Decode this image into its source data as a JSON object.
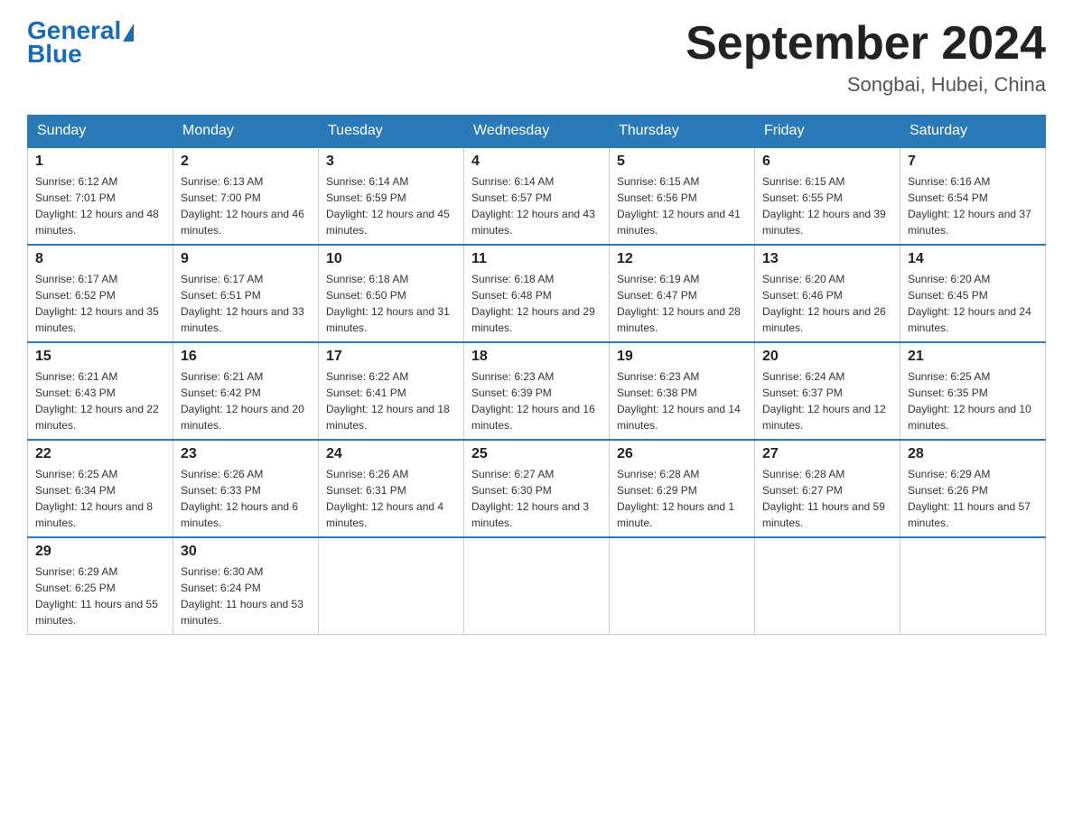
{
  "header": {
    "logo_general": "General",
    "logo_blue": "Blue",
    "month_title": "September 2024",
    "location": "Songbai, Hubei, China"
  },
  "days_of_week": [
    "Sunday",
    "Monday",
    "Tuesday",
    "Wednesday",
    "Thursday",
    "Friday",
    "Saturday"
  ],
  "weeks": [
    [
      {
        "day": "1",
        "sunrise": "6:12 AM",
        "sunset": "7:01 PM",
        "daylight": "12 hours and 48 minutes."
      },
      {
        "day": "2",
        "sunrise": "6:13 AM",
        "sunset": "7:00 PM",
        "daylight": "12 hours and 46 minutes."
      },
      {
        "day": "3",
        "sunrise": "6:14 AM",
        "sunset": "6:59 PM",
        "daylight": "12 hours and 45 minutes."
      },
      {
        "day": "4",
        "sunrise": "6:14 AM",
        "sunset": "6:57 PM",
        "daylight": "12 hours and 43 minutes."
      },
      {
        "day": "5",
        "sunrise": "6:15 AM",
        "sunset": "6:56 PM",
        "daylight": "12 hours and 41 minutes."
      },
      {
        "day": "6",
        "sunrise": "6:15 AM",
        "sunset": "6:55 PM",
        "daylight": "12 hours and 39 minutes."
      },
      {
        "day": "7",
        "sunrise": "6:16 AM",
        "sunset": "6:54 PM",
        "daylight": "12 hours and 37 minutes."
      }
    ],
    [
      {
        "day": "8",
        "sunrise": "6:17 AM",
        "sunset": "6:52 PM",
        "daylight": "12 hours and 35 minutes."
      },
      {
        "day": "9",
        "sunrise": "6:17 AM",
        "sunset": "6:51 PM",
        "daylight": "12 hours and 33 minutes."
      },
      {
        "day": "10",
        "sunrise": "6:18 AM",
        "sunset": "6:50 PM",
        "daylight": "12 hours and 31 minutes."
      },
      {
        "day": "11",
        "sunrise": "6:18 AM",
        "sunset": "6:48 PM",
        "daylight": "12 hours and 29 minutes."
      },
      {
        "day": "12",
        "sunrise": "6:19 AM",
        "sunset": "6:47 PM",
        "daylight": "12 hours and 28 minutes."
      },
      {
        "day": "13",
        "sunrise": "6:20 AM",
        "sunset": "6:46 PM",
        "daylight": "12 hours and 26 minutes."
      },
      {
        "day": "14",
        "sunrise": "6:20 AM",
        "sunset": "6:45 PM",
        "daylight": "12 hours and 24 minutes."
      }
    ],
    [
      {
        "day": "15",
        "sunrise": "6:21 AM",
        "sunset": "6:43 PM",
        "daylight": "12 hours and 22 minutes."
      },
      {
        "day": "16",
        "sunrise": "6:21 AM",
        "sunset": "6:42 PM",
        "daylight": "12 hours and 20 minutes."
      },
      {
        "day": "17",
        "sunrise": "6:22 AM",
        "sunset": "6:41 PM",
        "daylight": "12 hours and 18 minutes."
      },
      {
        "day": "18",
        "sunrise": "6:23 AM",
        "sunset": "6:39 PM",
        "daylight": "12 hours and 16 minutes."
      },
      {
        "day": "19",
        "sunrise": "6:23 AM",
        "sunset": "6:38 PM",
        "daylight": "12 hours and 14 minutes."
      },
      {
        "day": "20",
        "sunrise": "6:24 AM",
        "sunset": "6:37 PM",
        "daylight": "12 hours and 12 minutes."
      },
      {
        "day": "21",
        "sunrise": "6:25 AM",
        "sunset": "6:35 PM",
        "daylight": "12 hours and 10 minutes."
      }
    ],
    [
      {
        "day": "22",
        "sunrise": "6:25 AM",
        "sunset": "6:34 PM",
        "daylight": "12 hours and 8 minutes."
      },
      {
        "day": "23",
        "sunrise": "6:26 AM",
        "sunset": "6:33 PM",
        "daylight": "12 hours and 6 minutes."
      },
      {
        "day": "24",
        "sunrise": "6:26 AM",
        "sunset": "6:31 PM",
        "daylight": "12 hours and 4 minutes."
      },
      {
        "day": "25",
        "sunrise": "6:27 AM",
        "sunset": "6:30 PM",
        "daylight": "12 hours and 3 minutes."
      },
      {
        "day": "26",
        "sunrise": "6:28 AM",
        "sunset": "6:29 PM",
        "daylight": "12 hours and 1 minute."
      },
      {
        "day": "27",
        "sunrise": "6:28 AM",
        "sunset": "6:27 PM",
        "daylight": "11 hours and 59 minutes."
      },
      {
        "day": "28",
        "sunrise": "6:29 AM",
        "sunset": "6:26 PM",
        "daylight": "11 hours and 57 minutes."
      }
    ],
    [
      {
        "day": "29",
        "sunrise": "6:29 AM",
        "sunset": "6:25 PM",
        "daylight": "11 hours and 55 minutes."
      },
      {
        "day": "30",
        "sunrise": "6:30 AM",
        "sunset": "6:24 PM",
        "daylight": "11 hours and 53 minutes."
      },
      null,
      null,
      null,
      null,
      null
    ]
  ]
}
